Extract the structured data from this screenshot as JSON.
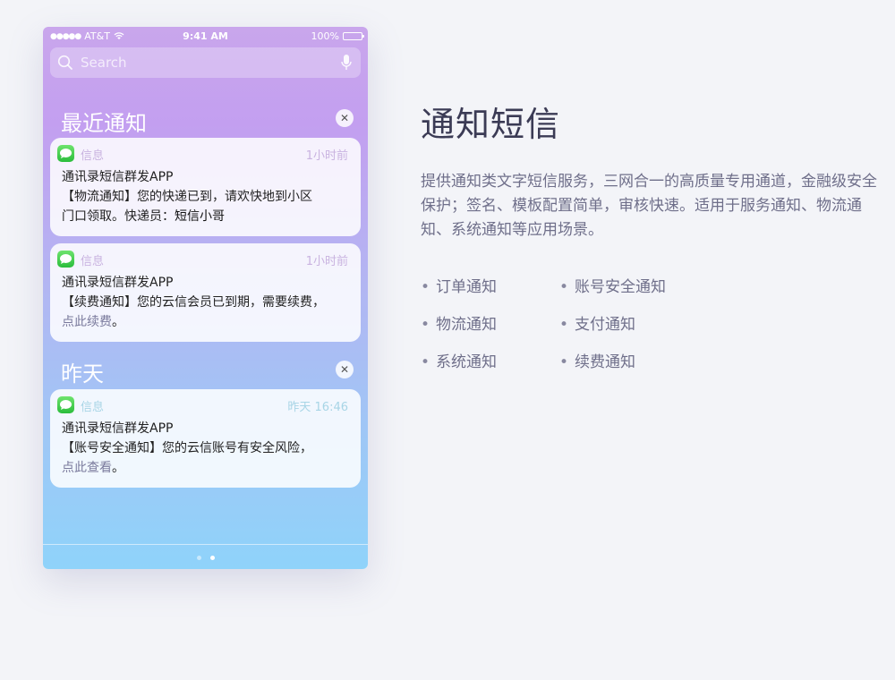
{
  "phone": {
    "status": {
      "carrier": "AT&T",
      "time": "9:41 AM",
      "battery": "100%"
    },
    "search": {
      "placeholder": "Search"
    },
    "sections": [
      {
        "title": "最近通知"
      },
      {
        "title": "昨天"
      }
    ],
    "cards": [
      {
        "app": "信息",
        "time": "1小时前",
        "sender": "通讯录短信群发APP",
        "line1": "【物流通知】您的快递已到，请欢快地到小区",
        "line2_prefix": "门口领取。快递员：",
        "line2_strong": "短信小哥"
      },
      {
        "app": "信息",
        "time": "1小时前",
        "sender": "通讯录短信群发APP",
        "line1": "【续费通知】您的云信会员已到期，需要续费，",
        "link": "点此续费",
        "end": "。"
      },
      {
        "app": "信息",
        "time": "昨天 16:46",
        "sender": "通讯录短信群发APP",
        "line1": "【账号安全通知】您的云信账号有安全风险，",
        "link": "点此查看",
        "end": "。"
      }
    ]
  },
  "content": {
    "title": "通知短信",
    "description": "提供通知类文字短信服务，三网合一的高质量专用通道，金融级安全保护；签名、模板配置简单，审核快速。适用于服务通知、物流通知、系统通知等应用场景。",
    "features": [
      "订单通知",
      "账号安全通知",
      "物流通知",
      "支付通知",
      "系统通知",
      "续费通知"
    ]
  }
}
